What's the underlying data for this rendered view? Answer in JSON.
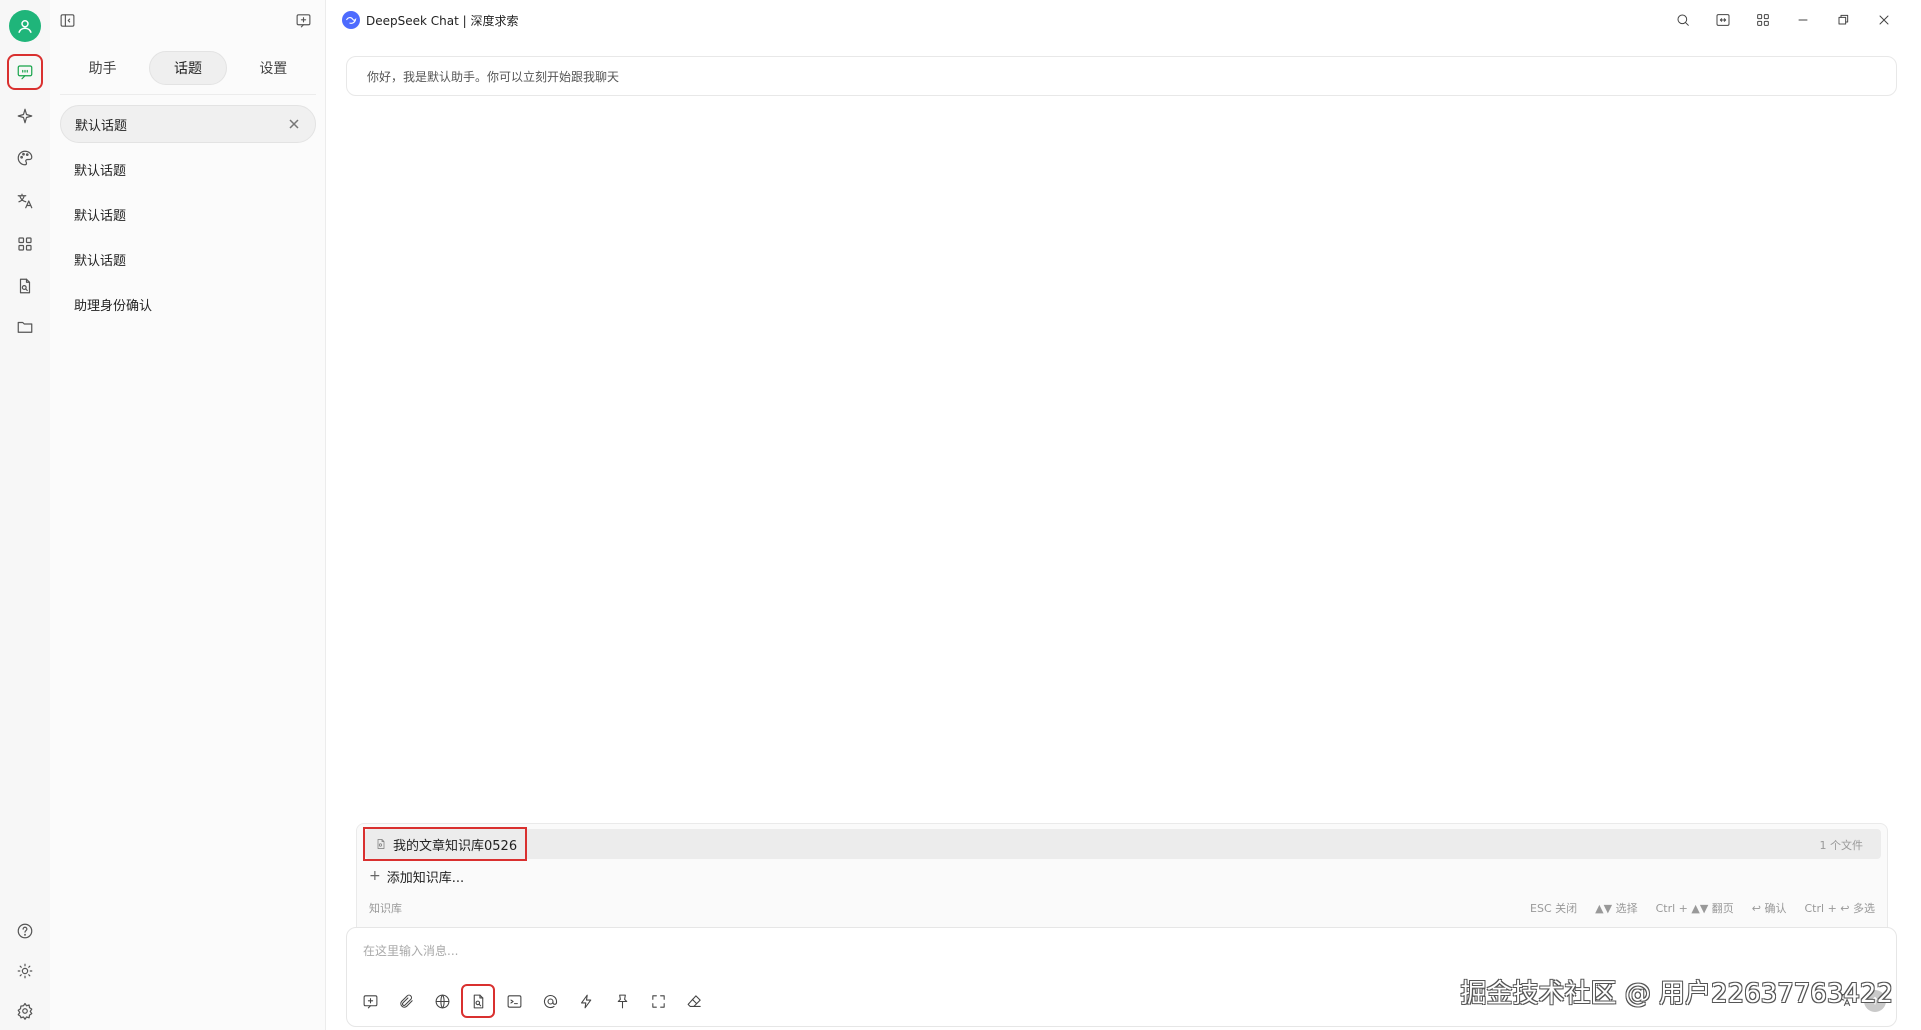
{
  "sidebar": {
    "tabs": [
      "助手",
      "话题",
      "设置"
    ],
    "active_tab": "话题",
    "topics": [
      {
        "label": "默认话题"
      },
      {
        "label": "默认话题"
      },
      {
        "label": "默认话题"
      },
      {
        "label": "默认话题"
      },
      {
        "label": "助理身份确认"
      }
    ]
  },
  "header": {
    "title": "DeepSeek Chat | 深度求索"
  },
  "chat": {
    "welcome_message": "你好，我是默认助手。你可以立刻开始跟我聊天"
  },
  "knowledge_popover": {
    "selected_kb": "我的文章知识库0526",
    "file_count": "1 个文件",
    "add_label": "添加知识库...",
    "section_label": "知识库",
    "hints": [
      "ESC 关闭",
      "▲▼ 选择",
      "Ctrl + ▲▼ 翻页",
      "↩ 确认",
      "Ctrl + ↩ 多选"
    ]
  },
  "input": {
    "placeholder": "在这里输入消息..."
  },
  "watermark": "掘金技术社区 @ 用户22637763422",
  "colors": {
    "accent_green": "#16a34a",
    "avatar": "#1fb57a",
    "highlight_red": "#d9302f",
    "deepseek_blue": "#4d6bfe"
  }
}
